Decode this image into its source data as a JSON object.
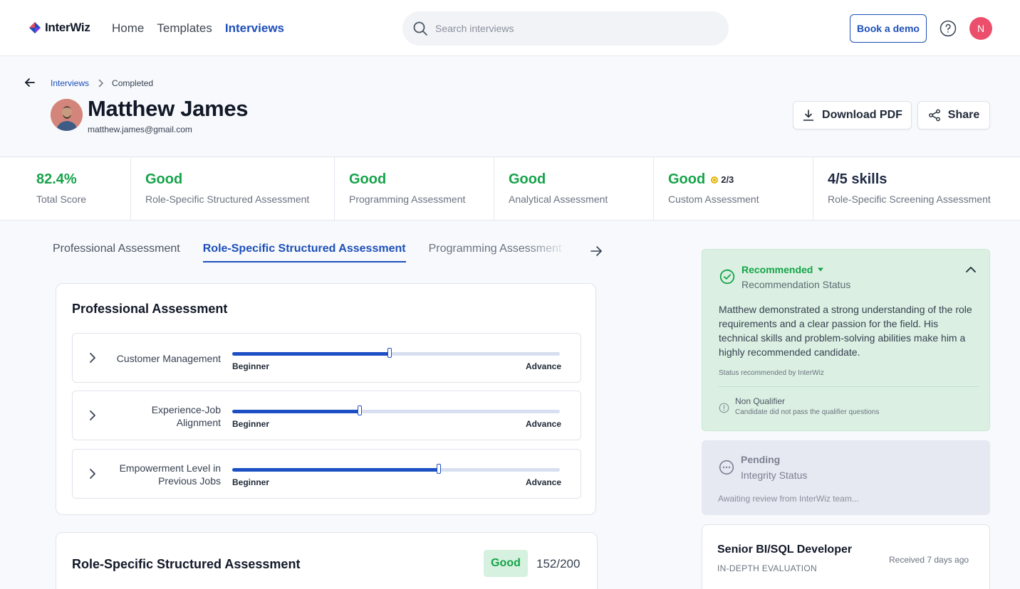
{
  "app": {
    "name": "InterWiz",
    "nav": [
      "Home",
      "Templates",
      "Interviews"
    ],
    "active_nav": "Interviews",
    "search_placeholder": "Search interviews",
    "demo_label": "Book a demo",
    "user_initial": "N",
    "colors": {
      "brand": "#1d4fb8",
      "good": "#16a34a",
      "avatar": "#ec4f6b"
    }
  },
  "header": {
    "breadcrumb": [
      "Interviews",
      "Completed"
    ],
    "name": "Matthew James",
    "email": "matthew.james@gmail.com",
    "pdf_label": "Download PDF",
    "share_label": "Share"
  },
  "scores": [
    {
      "value": "82.4%",
      "label": "Total Score"
    },
    {
      "value": "Good",
      "label": "Role-Specific Structured Assessment"
    },
    {
      "value": "Good",
      "label": "Programming Assessment"
    },
    {
      "value": "Good",
      "label": "Analytical Assessment"
    },
    {
      "value": "Good",
      "extra": "2/3",
      "label": "Custom Assessment"
    },
    {
      "value": "4/5 skills",
      "label": "Role-Specific Screening Assessment"
    }
  ],
  "tabs": [
    "Professional Assessment",
    "Role-Specific Structured Assessment",
    "Programming Assessment"
  ],
  "active_tab": "Role-Specific Structured Assessment",
  "professional": {
    "title": "Professional Assessment",
    "low_label": "Beginner",
    "high_label": "Advance",
    "skills": [
      {
        "name": "Customer Management",
        "level": 0.48
      },
      {
        "name": "Experience-Job Alignment",
        "level": 0.39
      },
      {
        "name": "Empowerment Level in Previous Jobs",
        "level": 0.63
      }
    ]
  },
  "role_specific": {
    "title": "Role-Specific Structured Assessment",
    "rating": "Good",
    "score": "152/200"
  },
  "recommendation": {
    "status": "Recommended",
    "caption": "Recommendation Status",
    "body": "Matthew demonstrated a strong understanding of the role requirements and a clear passion for the field. His technical skills and problem-solving abilities make him a highly recommended candidate.",
    "by": "Status recommended by InterWiz",
    "nq_title": "Non Qualifier",
    "nq_sub": "Candidate did not pass the qualifier questions"
  },
  "integrity": {
    "status": "Pending",
    "caption": "Integrity Status",
    "note": "Awaiting review from InterWiz team..."
  },
  "job": {
    "title": "Senior BI/SQL Developer",
    "sub": "IN-DEPTH EVALUATION",
    "received": "Received 7 days ago"
  }
}
